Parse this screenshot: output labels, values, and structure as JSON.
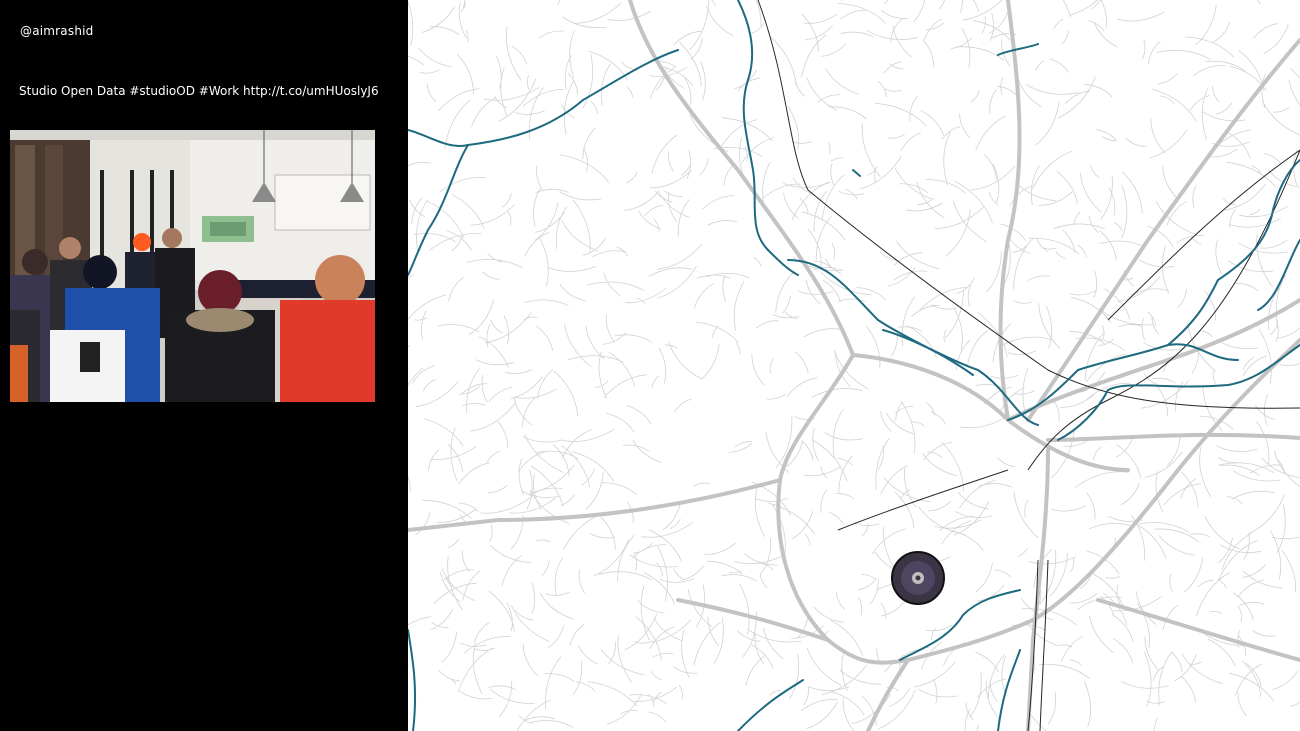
{
  "tweet": {
    "handle": "@aimrashid",
    "text": "Studio Open Data #studioOD #Work http://t.co/umHUoslyJ6"
  },
  "photo": {
    "subject": "people-in-studio-photo"
  },
  "map": {
    "river_color": "#1e6a80",
    "street_color": "#c8c8c8",
    "rail_color": "#222222",
    "marker_color": "#3a3444"
  }
}
